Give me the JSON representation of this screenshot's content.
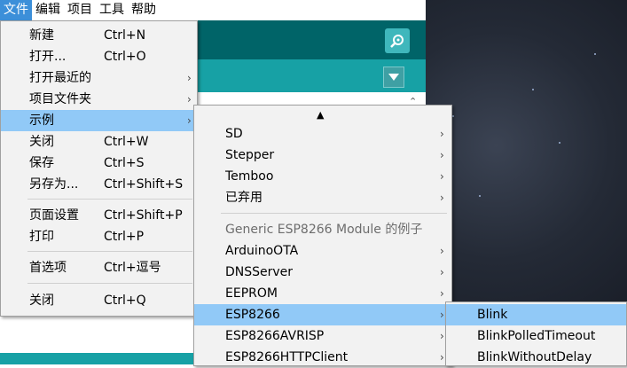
{
  "menubar": [
    "文件",
    "编辑",
    "项目",
    "工具",
    "帮助"
  ],
  "file_menu": {
    "items": [
      {
        "label": "新建",
        "shortcut": "Ctrl+N"
      },
      {
        "label": "打开...",
        "shortcut": "Ctrl+O"
      },
      {
        "label": "打开最近的",
        "arrow": "›"
      },
      {
        "label": "项目文件夹",
        "arrow": "›"
      },
      {
        "label": "示例",
        "arrow": "›"
      },
      {
        "label": "关闭",
        "shortcut": "Ctrl+W"
      },
      {
        "label": "保存",
        "shortcut": "Ctrl+S"
      },
      {
        "label": "另存为...",
        "shortcut": "Ctrl+Shift+S"
      },
      {
        "label": "页面设置",
        "shortcut": "Ctrl+Shift+P"
      },
      {
        "label": "打印",
        "shortcut": "Ctrl+P"
      },
      {
        "label": "首选项",
        "shortcut": "Ctrl+逗号"
      },
      {
        "label": "关闭",
        "shortcut": "Ctrl+Q"
      }
    ]
  },
  "examples_menu": {
    "scroll_up": "▲",
    "items": [
      {
        "label": "SD",
        "arrow": "›"
      },
      {
        "label": "Stepper",
        "arrow": "›"
      },
      {
        "label": "Temboo",
        "arrow": "›"
      },
      {
        "label": "已弃用",
        "arrow": "›"
      },
      {
        "label": "Generic ESP8266 Module 的例子"
      },
      {
        "label": "ArduinoOTA",
        "arrow": "›"
      },
      {
        "label": "DNSServer",
        "arrow": "›"
      },
      {
        "label": "EEPROM",
        "arrow": "›"
      },
      {
        "label": "ESP8266",
        "arrow": "›"
      },
      {
        "label": "ESP8266AVRISP",
        "arrow": "›"
      },
      {
        "label": "ESP8266HTTPClient",
        "arrow": "›"
      }
    ]
  },
  "esp8266_menu": {
    "items": [
      {
        "label": "Blink"
      },
      {
        "label": "BlinkPolledTimeout"
      },
      {
        "label": "BlinkWithoutDelay"
      }
    ]
  },
  "colors": {
    "toolbar": "#006468",
    "tabbar": "#17a1a5",
    "highlight": "#91c9f7",
    "menubar_active": "#3c8fd9"
  }
}
